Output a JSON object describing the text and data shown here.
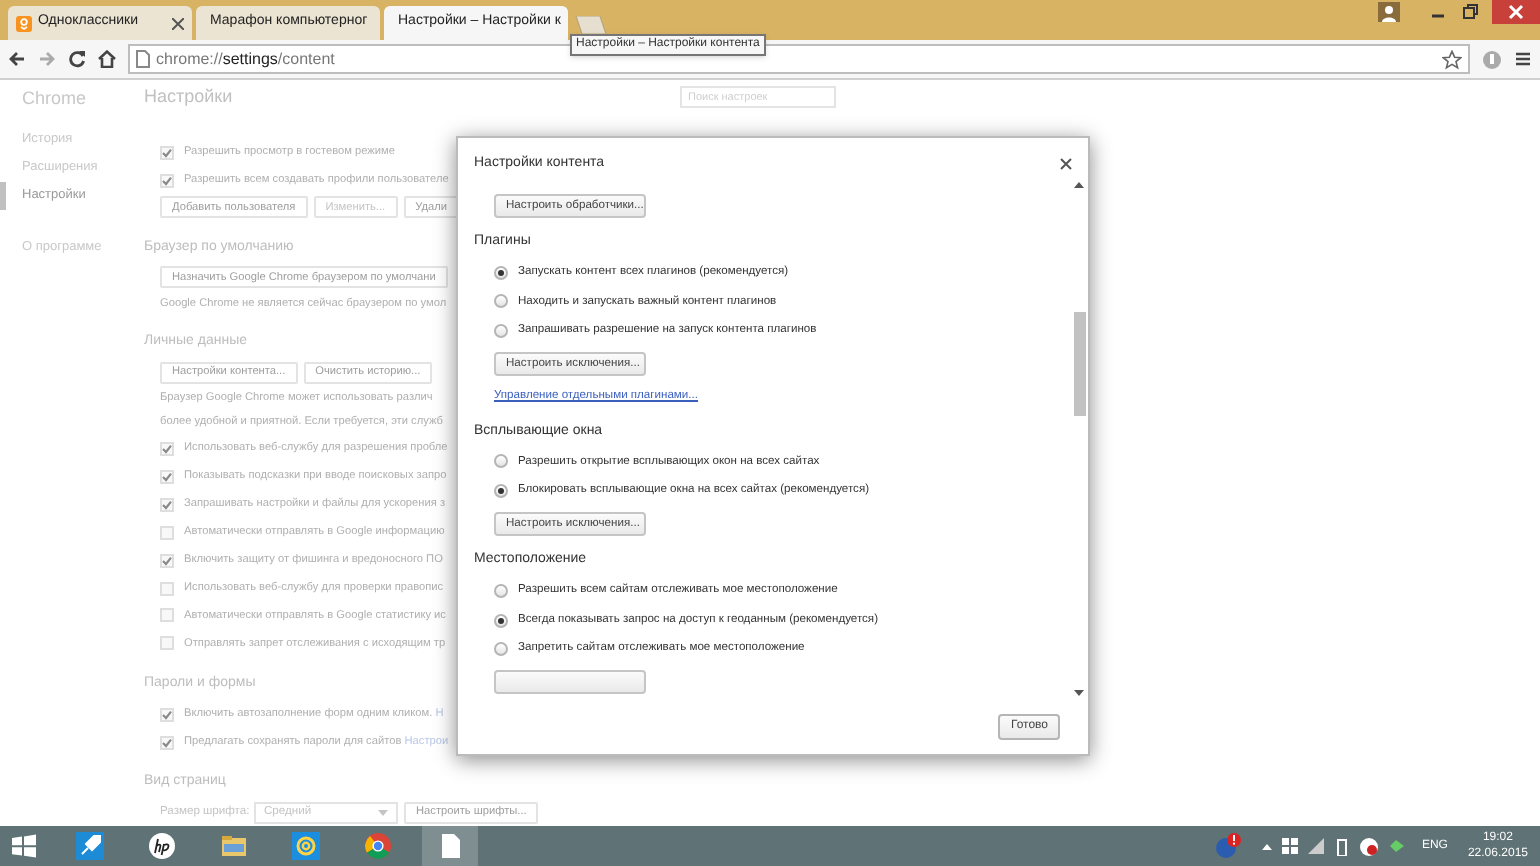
{
  "tabs": [
    {
      "title": "Одноклассники",
      "selected": false,
      "kind": "ok"
    },
    {
      "title": "Марафон компьютерног",
      "selected": false,
      "kind": "letter"
    },
    {
      "title": "Настройки – Настройки к",
      "selected": true,
      "kind": "gear"
    }
  ],
  "tooltip": "Настройки – Настройки контента",
  "address": "chrome://**settings**/content",
  "sidebar": {
    "title": "Chrome",
    "groups": [
      {
        "items": [
          {
            "label": "История",
            "selected": false
          },
          {
            "label": "Расширения",
            "selected": false
          },
          {
            "label": "Настройки",
            "selected": true
          }
        ]
      },
      {
        "items": [
          {
            "label": "О программе",
            "selected": false
          }
        ]
      }
    ]
  },
  "settings": {
    "title": "Настройки",
    "search_placeholder": "Поиск настроек",
    "blocks": [
      {
        "kind": "checkbox",
        "label": "Разрешить просмотр в гостевом режиме",
        "checked": true
      },
      {
        "kind": "checkbox",
        "label": "Разрешить всем создавать профили пользователе",
        "checked": true
      },
      {
        "kind": "buttons",
        "buttons": [
          {
            "label": "Добавить пользователя",
            "disabled": false
          },
          {
            "label": "Изменить...",
            "disabled": true
          },
          {
            "label": "Удали",
            "disabled": false
          }
        ]
      },
      {
        "kind": "heading",
        "text": "Браузер по умолчанию"
      },
      {
        "kind": "buttons",
        "buttons": [
          {
            "label": "Назначить Google Chrome браузером по умолчани",
            "disabled": false
          }
        ]
      },
      {
        "kind": "text",
        "text": "Google Chrome не является сейчас браузером по умол"
      },
      {
        "kind": "heading",
        "text": "Личные данные"
      },
      {
        "kind": "buttons",
        "buttons": [
          {
            "label": "Настройки контента...",
            "disabled": false
          },
          {
            "label": "Очистить историю...",
            "disabled": false
          }
        ]
      },
      {
        "kind": "text",
        "text": "Браузер Google Chrome может использовать различ"
      },
      {
        "kind": "text",
        "text": "более удобной и приятной. Если требуется, эти служб"
      },
      {
        "kind": "checkbox",
        "label": "Использовать веб-службу для разрешения пробле",
        "checked": true
      },
      {
        "kind": "checkbox",
        "label": "Показывать подсказки при вводе поисковых запро",
        "checked": true
      },
      {
        "kind": "checkbox",
        "label": "Запрашивать настройки и файлы для ускорения з",
        "checked": true
      },
      {
        "kind": "checkbox",
        "label": "Автоматически отправлять в Google информацию",
        "checked": false
      },
      {
        "kind": "checkbox",
        "label": "Включить защиту от фишинга и вредоносного ПО",
        "checked": true
      },
      {
        "kind": "checkbox",
        "label": "Использовать веб-службу для проверки правопис",
        "checked": false
      },
      {
        "kind": "checkbox",
        "label": "Автоматически отправлять в Google статистику ис",
        "checked": false
      },
      {
        "kind": "checkbox",
        "label": "Отправлять запрет отслеживания с исходящим тр",
        "checked": false
      },
      {
        "kind": "heading",
        "text": "Пароли и формы"
      },
      {
        "kind": "checkbox",
        "label": "Включить автозаполнение форм одним кликом.",
        "link": "Н",
        "checked": true
      },
      {
        "kind": "checkbox",
        "label": "Предлагать сохранять пароли для сайтов",
        "link": "Настрои",
        "checked": true
      },
      {
        "kind": "heading",
        "text": "Вид страниц"
      },
      {
        "kind": "select_row",
        "label": "Размер шрифта:",
        "value": "Средний",
        "button": "Настроить шрифты..."
      }
    ]
  },
  "dialog": {
    "title": "Настройки контента",
    "blocks": [
      {
        "kind": "button",
        "label": "Настроить обработчики..."
      },
      {
        "kind": "heading",
        "text": "Плагины"
      },
      {
        "kind": "radio",
        "label": "Запускать контент всех плагинов (рекомендуется)",
        "selected": true
      },
      {
        "kind": "radio",
        "label": "Находить и запускать важный контент плагинов",
        "selected": false
      },
      {
        "kind": "radio",
        "label": "Запрашивать разрешение на запуск контента плагинов",
        "selected": false
      },
      {
        "kind": "button",
        "label": "Настроить исключения..."
      },
      {
        "kind": "link",
        "text": "Управление отдельными плагинами..."
      },
      {
        "kind": "heading",
        "text": "Всплывающие окна"
      },
      {
        "kind": "radio",
        "label": "Разрешить открытие всплывающих окон на всех сайтах",
        "selected": false
      },
      {
        "kind": "radio",
        "label": "Блокировать всплывающие окна на всех сайтах (рекомендуется)",
        "selected": true
      },
      {
        "kind": "button",
        "label": "Настроить исключения..."
      },
      {
        "kind": "heading",
        "text": "Местоположение"
      },
      {
        "kind": "radio",
        "label": "Разрешить всем сайтам отслеживать мое местоположение",
        "selected": false
      },
      {
        "kind": "radio",
        "label": "Всегда показывать запрос на доступ к геоданным (рекомендуется)",
        "selected": true
      },
      {
        "kind": "radio",
        "label": "Запретить сайтам отслеживать мое местоположение",
        "selected": false
      },
      {
        "kind": "cut_button"
      }
    ],
    "done": "Готово"
  },
  "taskbar": {
    "language": "ENG",
    "time": "19:02",
    "date": "22.06.2015"
  }
}
